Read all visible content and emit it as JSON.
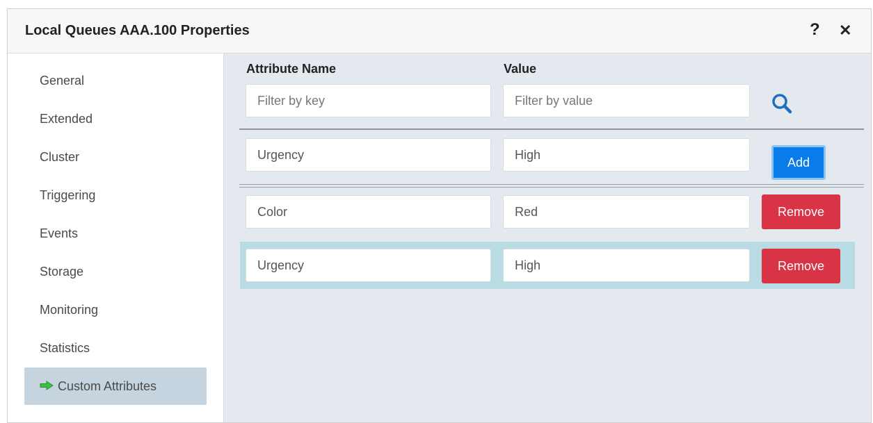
{
  "dialog": {
    "title": "Local Queues AAA.100 Properties",
    "help_label": "?",
    "close_label": "✕"
  },
  "sidebar": {
    "items": [
      {
        "label": "General"
      },
      {
        "label": "Extended"
      },
      {
        "label": "Cluster"
      },
      {
        "label": "Triggering"
      },
      {
        "label": "Events"
      },
      {
        "label": "Storage"
      },
      {
        "label": "Monitoring"
      },
      {
        "label": "Statistics"
      },
      {
        "label": "Custom Attributes",
        "active": true
      }
    ]
  },
  "attributes": {
    "headers": {
      "name": "Attribute Name",
      "value": "Value"
    },
    "filter": {
      "key_placeholder": "Filter by key",
      "value_placeholder": "Filter by value"
    },
    "new_entry": {
      "name": "Urgency",
      "value": "High",
      "add_label": "Add"
    },
    "rows": [
      {
        "name": "Color",
        "value": "Red",
        "remove_label": "Remove"
      },
      {
        "name": "Urgency",
        "value": "High",
        "remove_label": "Remove",
        "highlighted": true
      }
    ]
  },
  "colors": {
    "add_button": "#0a7bea",
    "remove_button": "#d93446",
    "row_highlight": "#b8dbe4",
    "arrow_icon": "#3fbf3f",
    "search_icon": "#1f6fbf"
  }
}
